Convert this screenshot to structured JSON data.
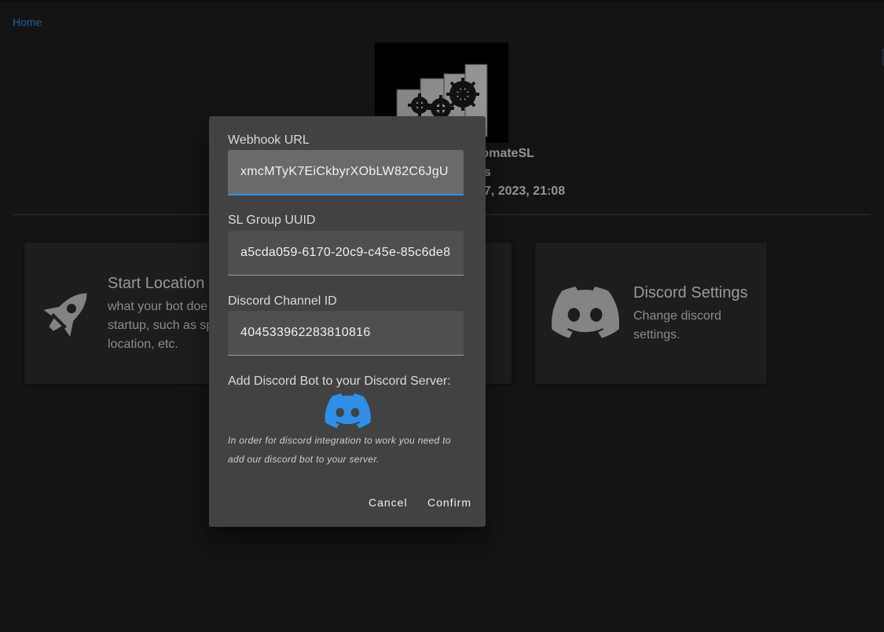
{
  "breadcrumb": {
    "home": "Home"
  },
  "bot": {
    "name_partial": "tomateSL",
    "status_partial": "ss",
    "date_partial": "17, 2023, 21:08"
  },
  "cards": [
    {
      "title": "Start Location",
      "description": "what your bot doe\nstartup, such as sp\nlocation, etc.",
      "icon": "rocket-icon"
    },
    {
      "title": "Discord Settings",
      "description": "Change discord\nsettings.",
      "icon": "discord-icon"
    }
  ],
  "dialog": {
    "webhook": {
      "label": "Webhook URL",
      "value": "xmcMTyK7EiCkbyrXObLW82C6JgU"
    },
    "group_uuid": {
      "label": "SL Group UUID",
      "value": "a5cda059-6170-20c9-c45e-85c6de8"
    },
    "channel_id": {
      "label": "Discord Channel ID",
      "value": "404533962283810816"
    },
    "add_bot_label": "Add Discord Bot to your Discord Server:",
    "add_bot_icon": "discord-icon",
    "hint": "In order for discord integration to work you need to add our discord bot to your server.",
    "cancel": "Cancel",
    "confirm": "Confirm"
  },
  "colors": {
    "accent": "#2f8fe6",
    "discord_blue": "#2f8fe6",
    "background": "#1f1f1f",
    "card": "#2d2d2d",
    "dialog": "#424242"
  }
}
